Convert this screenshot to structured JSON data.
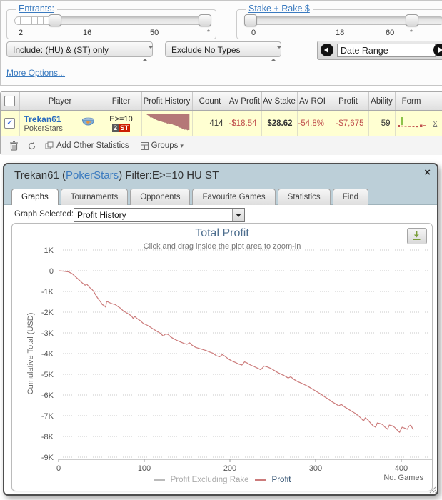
{
  "filters": {
    "entrants": {
      "label": "Entrants:",
      "ticks": [
        "2",
        "16",
        "50",
        "*"
      ]
    },
    "stake": {
      "label": "Stake + Rake $",
      "ticks": [
        "0",
        "18",
        "60",
        "*"
      ]
    },
    "include_dropdown": "Include: (HU) & (ST) only",
    "exclude_dropdown": "Exclude No Types",
    "date_range": "Date Range",
    "more_options": "More Options..."
  },
  "table": {
    "headers": [
      "Player",
      "Filter",
      "Profit History",
      "Count",
      "Av Profit",
      "Av Stake",
      "Av ROI",
      "Profit",
      "Ability",
      "Form"
    ],
    "row": {
      "player": "Trekan61",
      "site": "PokerStars",
      "filter": "E>=10",
      "badge_count": "2",
      "badge_type": "ST",
      "count": "414",
      "av_profit": "-$18.54",
      "av_stake": "$28.62",
      "av_roi": "-54.8%",
      "profit": "-$7,675",
      "ability": "59",
      "remove": "x",
      "checked": "✓"
    },
    "footer": {
      "add_stats": "Add Other Statistics",
      "groups": "Groups",
      "caret": "▾"
    }
  },
  "popup": {
    "title_pre": "Trekan61 (",
    "title_site": "PokerStars",
    "title_post": ") Filter:E>=10 HU ST",
    "close": "×",
    "tabs": [
      {
        "label": "Graphs",
        "active": true
      },
      {
        "label": "Tournaments",
        "active": false
      },
      {
        "label": "Opponents",
        "active": false
      },
      {
        "label": "Favourite Games",
        "active": false
      },
      {
        "label": "Statistics",
        "active": false
      },
      {
        "label": "Find",
        "active": false
      }
    ],
    "graph_selected_label": "Graph Selected:",
    "graph_selected_value": "Profit History"
  },
  "chart_data": {
    "type": "line",
    "title": "Total Profit",
    "subtitle": "Click and drag inside the plot area to zoom-in",
    "ylabel": "Cumulative Total (USD)",
    "xlabel": "No. Games",
    "ylim": [
      -9000,
      1000
    ],
    "xlim": [
      0,
      420
    ],
    "grid": "dotted-horizontal",
    "legend_position": "bottom-center",
    "yticks": [
      [
        1000,
        "1K"
      ],
      [
        0,
        "0"
      ],
      [
        -1000,
        "-1K"
      ],
      [
        -2000,
        "-2K"
      ],
      [
        -3000,
        "-3K"
      ],
      [
        -4000,
        "-4K"
      ],
      [
        -5000,
        "-5K"
      ],
      [
        -6000,
        "-6K"
      ],
      [
        -7000,
        "-7K"
      ],
      [
        -8000,
        "-8K"
      ],
      [
        -9000,
        "-9K"
      ]
    ],
    "xticks": [
      [
        0,
        "0"
      ],
      [
        100,
        "100"
      ],
      [
        200,
        "200"
      ],
      [
        300,
        "300"
      ],
      [
        400,
        "400"
      ]
    ],
    "legend": [
      {
        "label": "Profit Excluding Rake",
        "color": "#bbbbbb",
        "disabled": true
      },
      {
        "label": "Profit",
        "color": "#cc7b7b",
        "disabled": false
      }
    ],
    "series": [
      {
        "name": "Profit",
        "color": "#cc7b7b",
        "points": [
          [
            0,
            0
          ],
          [
            6,
            -20
          ],
          [
            12,
            -60
          ],
          [
            16,
            -150
          ],
          [
            20,
            -300
          ],
          [
            24,
            -450
          ],
          [
            28,
            -600
          ],
          [
            31,
            -700
          ],
          [
            33,
            -650
          ],
          [
            36,
            -800
          ],
          [
            39,
            -900
          ],
          [
            41,
            -1000
          ],
          [
            43,
            -1150
          ],
          [
            45,
            -1280
          ],
          [
            47,
            -1400
          ],
          [
            49,
            -1500
          ],
          [
            51,
            -1630
          ],
          [
            53,
            -1680
          ],
          [
            55,
            -1760
          ],
          [
            56,
            -1480
          ],
          [
            58,
            -1510
          ],
          [
            60,
            -1550
          ],
          [
            63,
            -1600
          ],
          [
            66,
            -1630
          ],
          [
            69,
            -1720
          ],
          [
            72,
            -1800
          ],
          [
            75,
            -1920
          ],
          [
            78,
            -2000
          ],
          [
            82,
            -2100
          ],
          [
            85,
            -2180
          ],
          [
            87,
            -2300
          ],
          [
            89,
            -2210
          ],
          [
            92,
            -2320
          ],
          [
            95,
            -2400
          ],
          [
            99,
            -2550
          ],
          [
            103,
            -2620
          ],
          [
            107,
            -2720
          ],
          [
            110,
            -2800
          ],
          [
            113,
            -2880
          ],
          [
            116,
            -2950
          ],
          [
            119,
            -3020
          ],
          [
            122,
            -3150
          ],
          [
            125,
            -3050
          ],
          [
            128,
            -3080
          ],
          [
            131,
            -3200
          ],
          [
            135,
            -3300
          ],
          [
            139,
            -3380
          ],
          [
            143,
            -3450
          ],
          [
            147,
            -3520
          ],
          [
            150,
            -3550
          ],
          [
            153,
            -3480
          ],
          [
            156,
            -3600
          ],
          [
            160,
            -3700
          ],
          [
            164,
            -3750
          ],
          [
            168,
            -3800
          ],
          [
            172,
            -3850
          ],
          [
            176,
            -3920
          ],
          [
            180,
            -3980
          ],
          [
            184,
            -4100
          ],
          [
            188,
            -4150
          ],
          [
            191,
            -4050
          ],
          [
            194,
            -4120
          ],
          [
            198,
            -4250
          ],
          [
            202,
            -4350
          ],
          [
            206,
            -4420
          ],
          [
            210,
            -4500
          ],
          [
            214,
            -4550
          ],
          [
            217,
            -4400
          ],
          [
            220,
            -4450
          ],
          [
            224,
            -4550
          ],
          [
            228,
            -4620
          ],
          [
            232,
            -4700
          ],
          [
            236,
            -4780
          ],
          [
            240,
            -4600
          ],
          [
            244,
            -4650
          ],
          [
            248,
            -4720
          ],
          [
            252,
            -4820
          ],
          [
            256,
            -4920
          ],
          [
            260,
            -5000
          ],
          [
            264,
            -5080
          ],
          [
            268,
            -5180
          ],
          [
            271,
            -5120
          ],
          [
            275,
            -5250
          ],
          [
            279,
            -5350
          ],
          [
            283,
            -5420
          ],
          [
            287,
            -5500
          ],
          [
            291,
            -5580
          ],
          [
            295,
            -5680
          ],
          [
            299,
            -5780
          ],
          [
            303,
            -5880
          ],
          [
            307,
            -5980
          ],
          [
            311,
            -6100
          ],
          [
            315,
            -6200
          ],
          [
            319,
            -6320
          ],
          [
            323,
            -6420
          ],
          [
            327,
            -6520
          ],
          [
            330,
            -6450
          ],
          [
            334,
            -6580
          ],
          [
            338,
            -6680
          ],
          [
            342,
            -6780
          ],
          [
            346,
            -6880
          ],
          [
            350,
            -7000
          ],
          [
            353,
            -7120
          ],
          [
            356,
            -7250
          ],
          [
            358,
            -7100
          ],
          [
            361,
            -7200
          ],
          [
            364,
            -7350
          ],
          [
            367,
            -7480
          ],
          [
            370,
            -7550
          ],
          [
            372,
            -7350
          ],
          [
            375,
            -7380
          ],
          [
            378,
            -7420
          ],
          [
            381,
            -7550
          ],
          [
            384,
            -7650
          ],
          [
            386,
            -7450
          ],
          [
            389,
            -7480
          ],
          [
            392,
            -7550
          ],
          [
            395,
            -7680
          ],
          [
            398,
            -7800
          ],
          [
            401,
            -7550
          ],
          [
            404,
            -7600
          ],
          [
            407,
            -7650
          ],
          [
            409,
            -7500
          ],
          [
            411,
            -7450
          ],
          [
            413,
            -7600
          ],
          [
            414,
            -7675
          ]
        ]
      }
    ]
  },
  "colors": {
    "loss_red": "#c0504d",
    "link_blue": "#3a7abf",
    "row_yellow": "#ffffd2",
    "popup_header": "#bccfd8",
    "chart_line": "#cc7b7b",
    "chart_title": "#4d6e8e",
    "badge_red": "#cc1f00",
    "spark_fill": "#b57878"
  }
}
